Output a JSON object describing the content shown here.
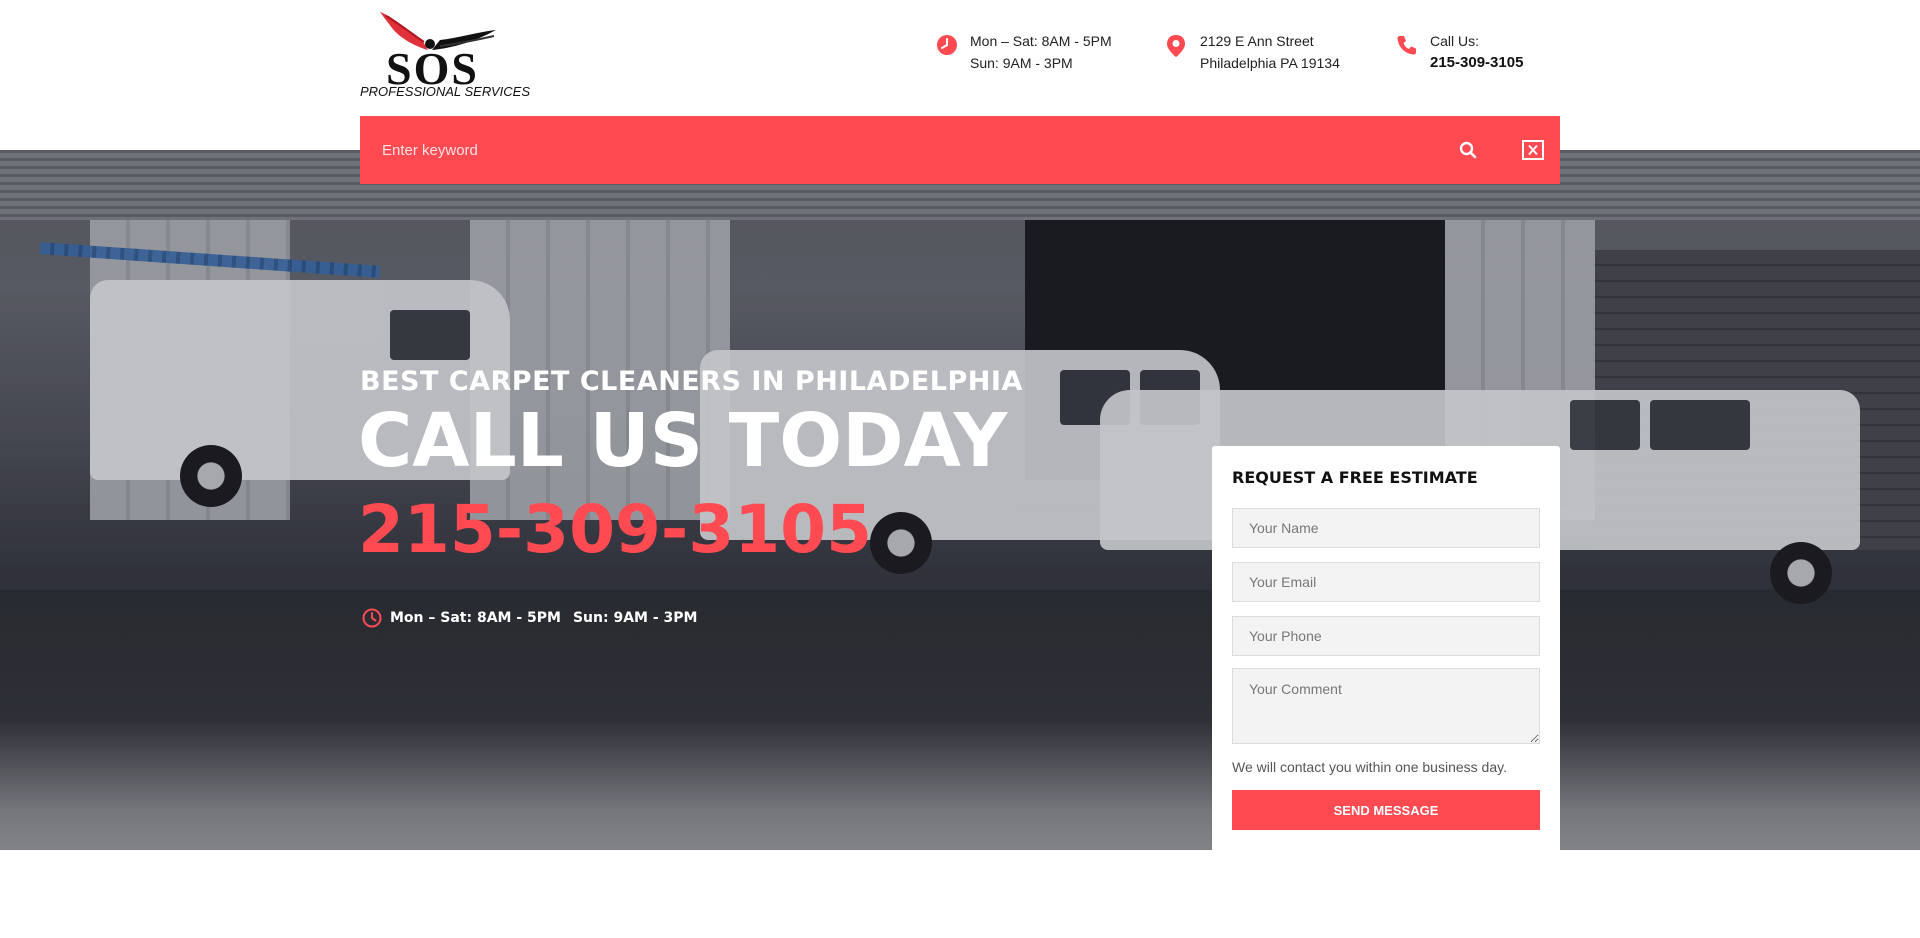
{
  "brand": {
    "wordmark": "SOS",
    "tagline": "PROFESSIONAL SERVICES",
    "accent_color": "#ff4a52"
  },
  "header": {
    "hours": {
      "icon": "clock-icon",
      "line1": "Mon – Sat: 8AM - 5PM",
      "line2": "Sun: 9AM - 3PM"
    },
    "address": {
      "icon": "map-pin-icon",
      "line1": "2129 E Ann Street",
      "line2": "Philadelphia PA 19134"
    },
    "call": {
      "icon": "phone-icon",
      "line1": "Call Us:",
      "line2": "215-309-3105"
    }
  },
  "search": {
    "placeholder": "Enter keyword",
    "search_icon": "search-icon",
    "close_icon": "close-icon"
  },
  "hero": {
    "subtitle": "BEST CARPET CLEANERS IN PHILADELPHIA",
    "title": "CALL US TODAY",
    "phone": "215-309-3105",
    "hours_weekday": "Mon – Sat: 8AM - 5PM",
    "hours_sunday": "Sun: 9AM - 3PM"
  },
  "form": {
    "title": "REQUEST A FREE ESTIMATE",
    "name_placeholder": "Your Name",
    "email_placeholder": "Your Email",
    "phone_placeholder": "Your Phone",
    "comment_placeholder": "Your Comment",
    "note": "We will contact you within one business day.",
    "submit_label": "SEND MESSAGE"
  }
}
